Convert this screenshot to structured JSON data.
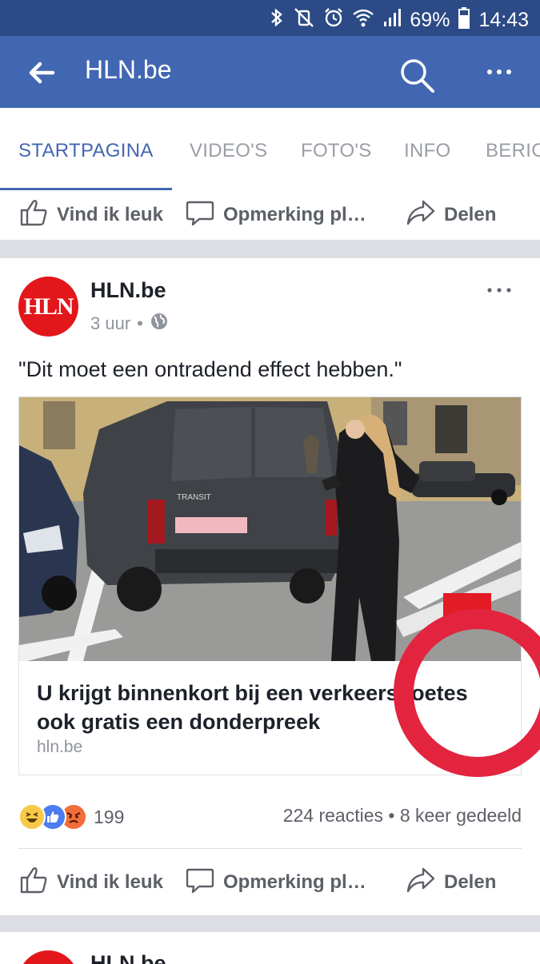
{
  "status_bar": {
    "battery": "69%",
    "time": "14:43",
    "icons": [
      "bluetooth-icon",
      "vibrate-mute-icon",
      "alarm-icon",
      "wifi-icon",
      "signal-icon",
      "battery-icon"
    ]
  },
  "app_bar": {
    "title": "HLN.be",
    "icons": [
      "back-arrow-icon",
      "search-icon",
      "more-icon"
    ]
  },
  "tabs": [
    {
      "label": "STARTPAGINA",
      "active": true
    },
    {
      "label": "VIDEO'S",
      "active": false
    },
    {
      "label": "FOTO'S",
      "active": false
    },
    {
      "label": "INFO",
      "active": false
    },
    {
      "label": "BERIC",
      "active": false
    }
  ],
  "actions": {
    "like": "Vind ik leuk",
    "comment": "Opmerking pl…",
    "share": "Delen"
  },
  "post": {
    "page_name": "HLN.be",
    "avatar_text": "HLN",
    "time": "3 uur",
    "separator": "•",
    "text": "\"Dit moet een ontradend effect hebben.\"",
    "link": {
      "headline": "U krijgt binnenkort bij een verkeersboetes ook gratis een donderpreek",
      "domain": "hln.be",
      "photo_van_text": "TRANSIT"
    },
    "reactions": {
      "types": [
        "haha",
        "like",
        "angry"
      ],
      "count": "199"
    },
    "stats": "224 reacties • 8 keer gedeeld"
  },
  "next_post": {
    "page_name": "HLN.be"
  },
  "colors": {
    "status_bar": "#2c4a86",
    "app_bar": "#4267b2",
    "accent": "#4267b2",
    "annotation_circle": "#e2243f",
    "hln_red": "#e3161b"
  }
}
